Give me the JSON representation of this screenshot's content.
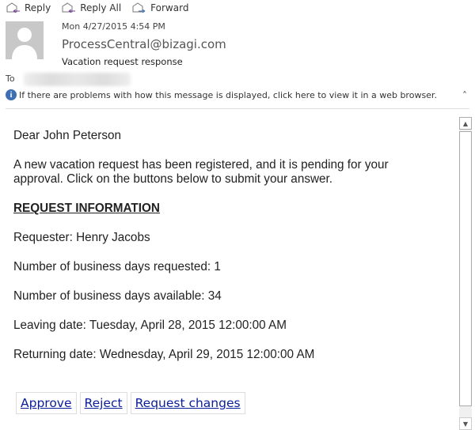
{
  "toolbar": {
    "reply": "Reply",
    "reply_all": "Reply All",
    "forward": "Forward"
  },
  "header": {
    "date": "Mon 4/27/2015 4:54 PM",
    "from": "ProcessCentral@bizagi.com",
    "subject": "Vacation request response",
    "to_label": "To",
    "info": "If there are problems with how this message is displayed, click here to view it in a web browser."
  },
  "message": {
    "greeting": "Dear John Peterson",
    "intro": "A new vacation request has been registered, and it is pending for your approval. Click on the buttons below to submit your answer.",
    "section_title": "REQUEST INFORMATION",
    "lines": [
      "Requester: Henry Jacobs",
      "Number of business days requested: 1",
      "Number of business days available: 34",
      "Leaving date: Tuesday, April 28, 2015 12:00:00 AM",
      "Returning date: Wednesday, April 29, 2015 12:00:00 AM"
    ],
    "buttons": [
      "Approve",
      "Reject",
      "Request changes"
    ]
  },
  "colors": {
    "link": "#0a1e9c",
    "info_icon": "#3c6fb4"
  }
}
